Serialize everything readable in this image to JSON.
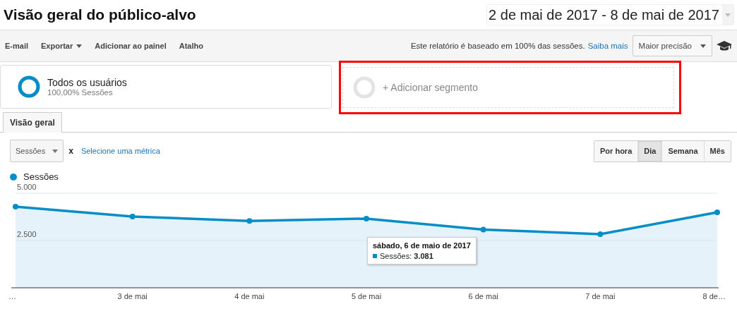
{
  "header": {
    "title": "Visão geral do público-alvo",
    "date_range": "2 de mai de 2017 - 8 de mai de 2017"
  },
  "toolbar": {
    "actions": [
      {
        "label": "E-mail",
        "dropdown": false
      },
      {
        "label": "Exportar",
        "dropdown": true
      },
      {
        "label": "Adicionar ao painel",
        "dropdown": false
      },
      {
        "label": "Atalho",
        "dropdown": false
      }
    ],
    "notice": "Este relatório é baseado em 100% das sessões.",
    "notice_link": "Saiba mais",
    "precision": "Maior precisão"
  },
  "segments": [
    {
      "kind": "active",
      "name": "Todos os usuários",
      "detail": "100,00% Sessões"
    },
    {
      "kind": "add",
      "name": "+ Adicionar segmento",
      "highlighted": true
    }
  ],
  "tabs": [
    {
      "label": "Visão geral",
      "selected": true
    }
  ],
  "metric": {
    "value": "Sessões",
    "remove": "x",
    "link": "Selecione uma métrica"
  },
  "intervals": [
    {
      "label": "Por hora",
      "selected": false
    },
    {
      "label": "Dia",
      "selected": true
    },
    {
      "label": "Semana",
      "selected": false
    },
    {
      "label": "Mês",
      "selected": false
    }
  ],
  "chart": {
    "tooltip_title": "sábado, 6 de maio de 2017",
    "tooltip_label": "Sessões:",
    "tooltip_value": "3.081",
    "chart_data": {
      "type": "area",
      "categories": [
        "…",
        "3 de mai",
        "4 de mai",
        "5 de mai",
        "6 de mai",
        "7 de mai",
        "8 de…"
      ],
      "series": [
        {
          "name": "Sessões",
          "color": "#058dc7",
          "values": [
            4290,
            3770,
            3540,
            3660,
            3081,
            2840,
            3990
          ]
        }
      ],
      "ylim": [
        0,
        5000
      ],
      "yticks": [
        {
          "value": 5000,
          "label": "5.000"
        },
        {
          "value": 2500,
          "label": "2.500"
        }
      ]
    }
  }
}
